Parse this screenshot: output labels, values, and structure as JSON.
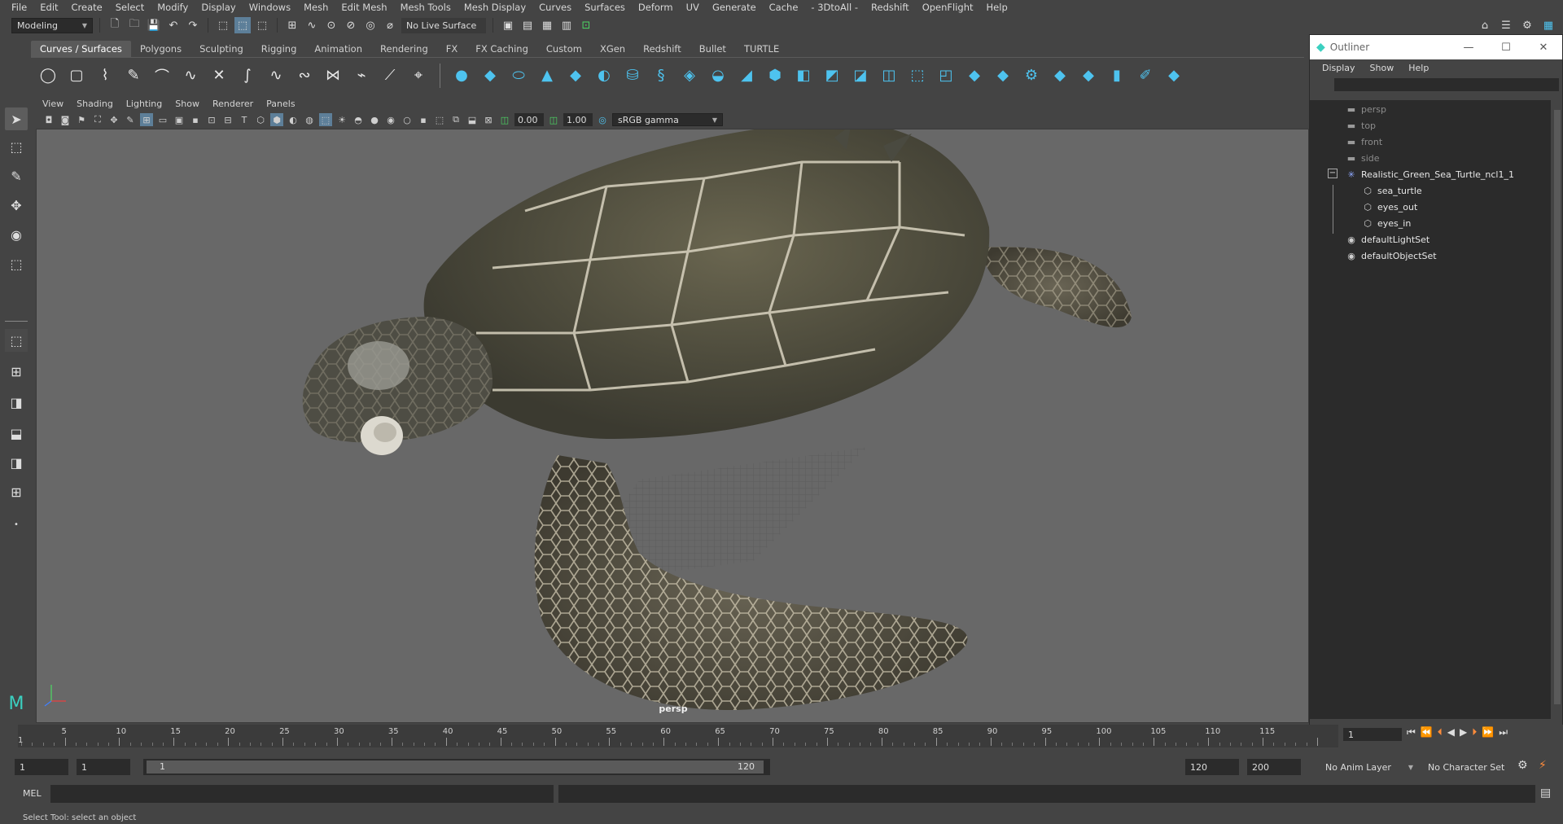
{
  "menubar": [
    "File",
    "Edit",
    "Create",
    "Select",
    "Modify",
    "Display",
    "Windows",
    "Mesh",
    "Edit Mesh",
    "Mesh Tools",
    "Mesh Display",
    "Curves",
    "Surfaces",
    "Deform",
    "UV",
    "Generate",
    "Cache",
    "- 3DtoAll -",
    "Redshift",
    "OpenFlight",
    "Help"
  ],
  "statusline": {
    "workspace": "Modeling",
    "live_surface": "No Live Surface"
  },
  "shelf_tabs": [
    "Curves / Surfaces",
    "Polygons",
    "Sculpting",
    "Rigging",
    "Animation",
    "Rendering",
    "FX",
    "FX Caching",
    "Custom",
    "XGen",
    "Redshift",
    "Bullet",
    "TURTLE"
  ],
  "shelf_active_tab": 0,
  "panel": {
    "menus": [
      "View",
      "Shading",
      "Lighting",
      "Show",
      "Renderer",
      "Panels"
    ],
    "exposure": "0.00",
    "gamma": "1.00",
    "color_space": "sRGB gamma",
    "camera_label": "persp"
  },
  "outliner": {
    "title": "Outliner",
    "menus": [
      "Display",
      "Show",
      "Help"
    ],
    "nodes": [
      {
        "label": "persp",
        "icon": "camera-icon",
        "dim": true,
        "indent": 0
      },
      {
        "label": "top",
        "icon": "camera-icon",
        "dim": true,
        "indent": 0
      },
      {
        "label": "front",
        "icon": "camera-icon",
        "dim": true,
        "indent": 0
      },
      {
        "label": "side",
        "icon": "camera-icon",
        "dim": true,
        "indent": 0
      },
      {
        "label": "Realistic_Green_Sea_Turtle_ncl1_1",
        "icon": "transform-group-icon",
        "dim": false,
        "indent": 0
      },
      {
        "label": "sea_turtle",
        "icon": "mesh-icon",
        "dim": false,
        "indent": 1
      },
      {
        "label": "eyes_out",
        "icon": "mesh-icon",
        "dim": false,
        "indent": 1
      },
      {
        "label": "eyes_in",
        "icon": "mesh-icon",
        "dim": false,
        "indent": 1
      },
      {
        "label": "defaultLightSet",
        "icon": "set-icon",
        "dim": false,
        "indent": 0
      },
      {
        "label": "defaultObjectSet",
        "icon": "set-icon",
        "dim": false,
        "indent": 0
      }
    ]
  },
  "timeline": {
    "ticks": [
      "5",
      "10",
      "15",
      "20",
      "25",
      "30",
      "35",
      "40",
      "45",
      "50",
      "55",
      "60",
      "65",
      "70",
      "75",
      "80",
      "85",
      "90",
      "95",
      "100",
      "105",
      "110",
      "115"
    ],
    "start_marker": "1",
    "current_frame": "1"
  },
  "range": {
    "start": "1",
    "playback_start": "1",
    "slider_start": "1",
    "slider_end": "120",
    "playback_end": "120",
    "end": "200",
    "anim_layer": "No Anim Layer",
    "character_set": "No Character Set"
  },
  "cmdline": {
    "label": "MEL"
  },
  "helpline": "Select Tool: select an object"
}
